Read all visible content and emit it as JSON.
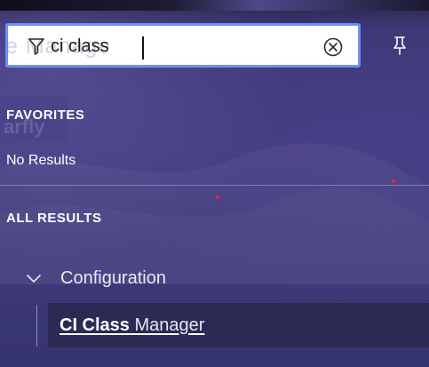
{
  "search": {
    "value": "ci class",
    "ghost_text": "e Manage",
    "filter_icon": "filter-icon",
    "clear_icon": "circle-x-icon"
  },
  "header": {
    "pin_icon": "pin-icon"
  },
  "favorites": {
    "heading": "FAVORITES",
    "ghost_text": "arfly",
    "empty_text": "No Results"
  },
  "all_results": {
    "heading": "ALL RESULTS",
    "groups": [
      {
        "label": "Configuration",
        "expanded": true,
        "chevron_icon": "chevron-down-icon",
        "items": [
          {
            "match": "CI Class",
            "rest": " Manager"
          }
        ]
      }
    ]
  },
  "colors": {
    "focus_border": "#6f8dff",
    "background": "#3f3a7c",
    "selected_item": "#2c2a54",
    "marker_dot": "#ff2030"
  }
}
